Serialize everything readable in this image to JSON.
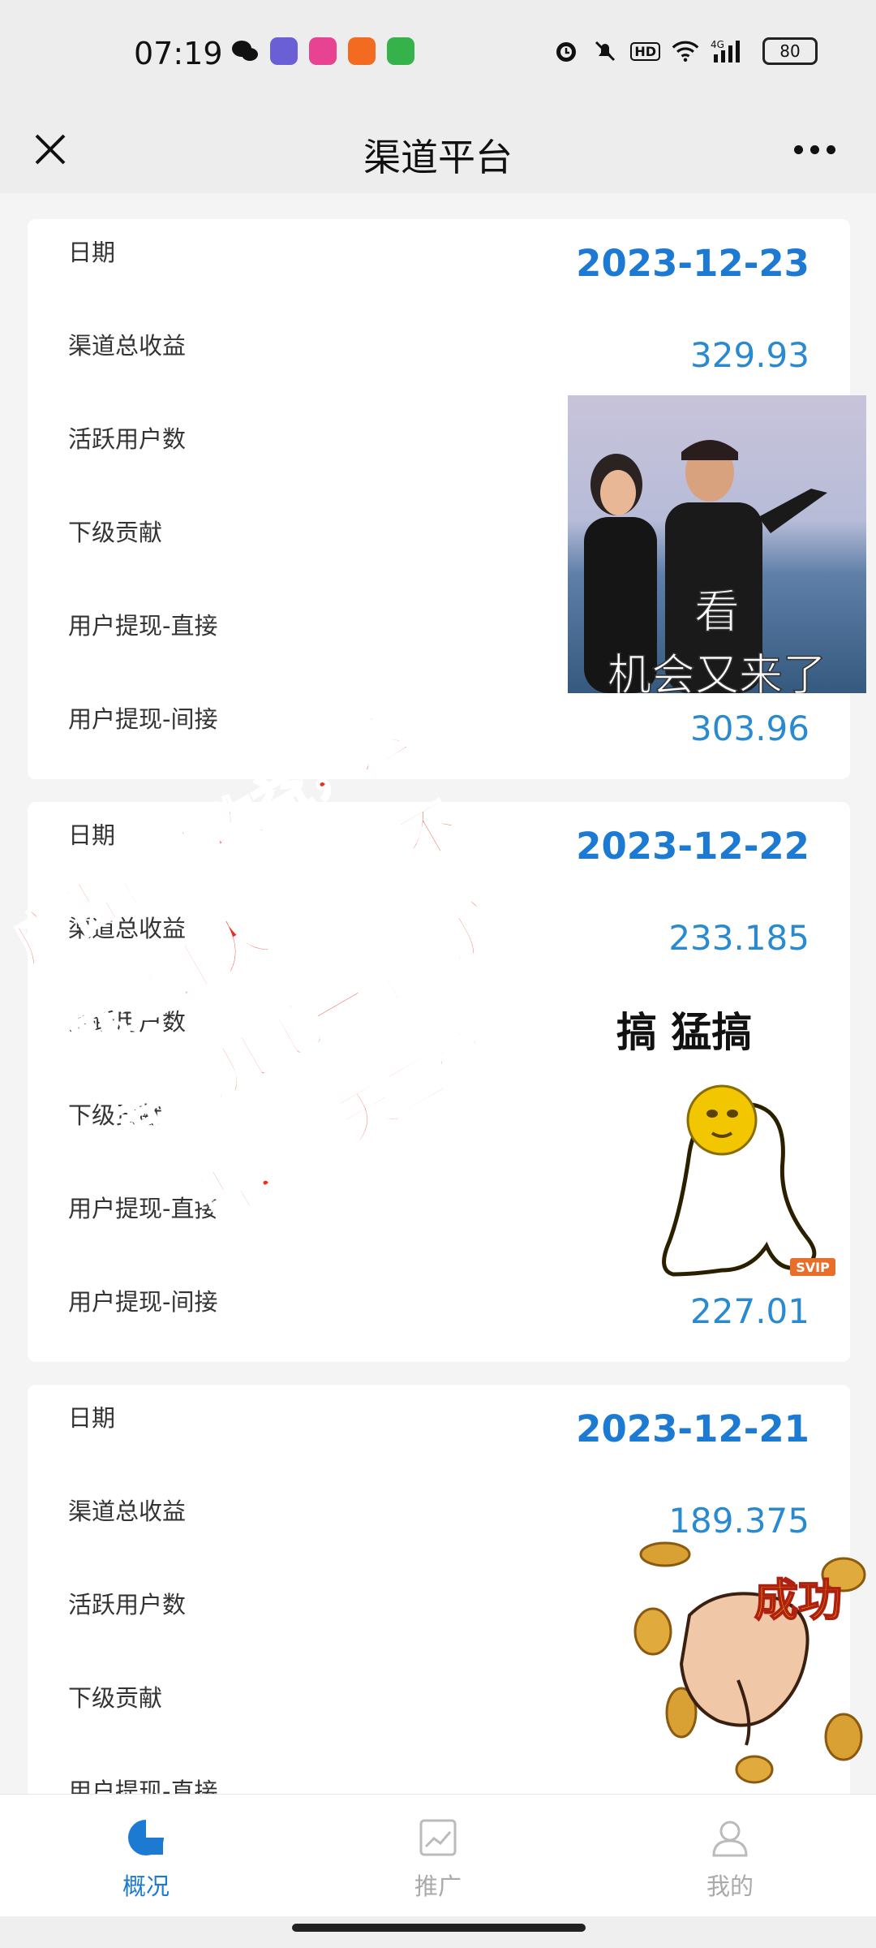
{
  "status": {
    "time": "07:19",
    "battery": "80",
    "hd": "HD",
    "signal": "4G"
  },
  "header": {
    "title": "渠道平台"
  },
  "cards": [
    {
      "rows": [
        {
          "label": "日期",
          "value": "2023-12-23"
        },
        {
          "label": "渠道总收益",
          "value": "329.93"
        },
        {
          "label": "活跃用户数",
          "value": ""
        },
        {
          "label": "下级贡献",
          "value": ""
        },
        {
          "label": "用户提现-直接",
          "value": ""
        },
        {
          "label": "用户提现-间接",
          "value": "303.96"
        }
      ]
    },
    {
      "rows": [
        {
          "label": "日期",
          "value": "2023-12-22"
        },
        {
          "label": "渠道总收益",
          "value": "233.185"
        },
        {
          "label": "活跃用户数",
          "value": ""
        },
        {
          "label": "下级贡献",
          "value": ""
        },
        {
          "label": "用户提现-直接",
          "value": ""
        },
        {
          "label": "用户提现-间接",
          "value": "227.01"
        }
      ]
    },
    {
      "rows": [
        {
          "label": "日期",
          "value": "2023-12-21"
        },
        {
          "label": "渠道总收益",
          "value": "189.375"
        },
        {
          "label": "活跃用户数",
          "value": ""
        },
        {
          "label": "下级贡献",
          "value": ""
        },
        {
          "label": "用户提现-直接",
          "value": ""
        }
      ]
    }
  ],
  "overlay": {
    "lines": [
      "广告管道收益，这",
      "就是让人有点瞧不",
      "起的几毛一条的广",
      "告，每天三位数"
    ]
  },
  "stickers": {
    "s1_caption_top": "看",
    "s1_caption_bottom": "机会又来了",
    "s2_title": "搞 猛搞",
    "s2_badge": "SVIP",
    "s3_text": "成功"
  },
  "tabs": [
    {
      "label": "概况",
      "active": true
    },
    {
      "label": "推广",
      "active": false
    },
    {
      "label": "我的",
      "active": false
    }
  ],
  "colors": {
    "accent": "#1c7ad3",
    "value": "#2a8ad0",
    "overlay_text": "#f02b18"
  }
}
